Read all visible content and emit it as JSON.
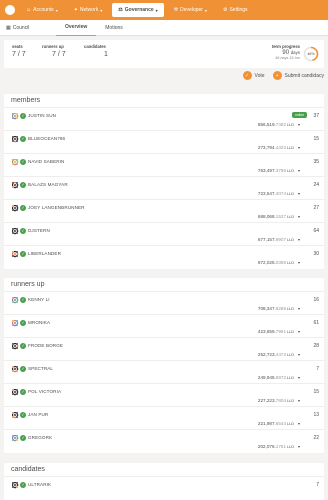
{
  "nav": {
    "items": [
      {
        "label": "Accounts",
        "icon": "user-icon",
        "glyph": "☺",
        "active": false
      },
      {
        "label": "Network",
        "icon": "network-icon",
        "glyph": "✦",
        "active": false
      },
      {
        "label": "Governance",
        "icon": "governance-icon",
        "glyph": "⚖",
        "active": true
      },
      {
        "label": "Developer",
        "icon": "code-icon",
        "glyph": "⚒",
        "active": false
      },
      {
        "label": "Settings",
        "icon": "gear-icon",
        "glyph": "⚙",
        "active": false
      }
    ],
    "accent": "#f19135"
  },
  "subnav": {
    "breadcrumb": "Council",
    "tabs": [
      "Overview",
      "Motions"
    ],
    "active_tab": "Overview"
  },
  "summary": {
    "seats_label": "seats",
    "seats_value": "7 / 7",
    "runners_label": "runners up",
    "runners_value": "7 / 7",
    "candidates_label": "candidates",
    "candidates_value": "1",
    "term_label": "term progress",
    "term_value": "90",
    "term_unit": "days",
    "term_remaining": "48 days 15 hrs",
    "progress_text": "46%",
    "progress_fraction": 0.46
  },
  "actions": {
    "vote": "Vote",
    "submit": "Submit candidacy"
  },
  "members": {
    "title": "members",
    "rows": [
      {
        "name": "JUSTIN SUN",
        "badge": "online",
        "count": "37",
        "bal_int": "856,519.",
        "bal_dec": "7492",
        "unit": "LLD"
      },
      {
        "name": "BLUEOCEAN786",
        "badge": "",
        "count": "15",
        "bal_int": "273,794.",
        "bal_dec": "4323",
        "unit": "LLD"
      },
      {
        "name": "NAVID SABERIN",
        "badge": "",
        "count": "35",
        "bal_int": "763,497.",
        "bal_dec": "3756",
        "unit": "LLD"
      },
      {
        "name": "BALAZS MAGYAR",
        "badge": "",
        "count": "24",
        "bal_int": "723,547.",
        "bal_dec": "4074",
        "unit": "LLD"
      },
      {
        "name": "JOEY LANGENBRUNNER",
        "badge": "",
        "count": "27",
        "bal_int": "688,068.",
        "bal_dec": "1527",
        "unit": "LLD"
      },
      {
        "name": "DJSTERN",
        "badge": "",
        "count": "64",
        "bal_int": "677,157.",
        "bal_dec": "9907",
        "unit": "LLD"
      },
      {
        "name": "LIBERLANDER",
        "badge": "",
        "count": "30",
        "bal_int": "972,025.",
        "bal_dec": "0388",
        "unit": "LLD"
      }
    ]
  },
  "runners": {
    "title": "runners up",
    "rows": [
      {
        "name": "KENNY LI",
        "badge": "",
        "count": "16",
        "bal_int": "708,347.",
        "bal_dec": "8286",
        "unit": "LLD"
      },
      {
        "name": "MRONIKA",
        "badge": "",
        "count": "61",
        "bal_int": "423,659.",
        "bal_dec": "7961",
        "unit": "LLD"
      },
      {
        "name": "FRODE BORGE",
        "badge": "",
        "count": "28",
        "bal_int": "252,723.",
        "bal_dec": "4472",
        "unit": "LLD"
      },
      {
        "name": "SPECTRAL",
        "badge": "",
        "count": "7",
        "bal_int": "249,945.",
        "bal_dec": "6972",
        "unit": "LLD"
      },
      {
        "name": "POL VICTORIA",
        "badge": "",
        "count": "15",
        "bal_int": "227,223.",
        "bal_dec": "7804",
        "unit": "LLD"
      },
      {
        "name": "JAN PUR",
        "badge": "",
        "count": "13",
        "bal_int": "221,987.",
        "bal_dec": "6544",
        "unit": "LLD"
      },
      {
        "name": "GREGORK",
        "badge": "",
        "count": "22",
        "bal_int": "202,076.",
        "bal_dec": "1751",
        "unit": "LLD"
      }
    ]
  },
  "candidates": {
    "title": "candidates",
    "rows": [
      {
        "name": "ULTRARIK",
        "badge": "",
        "count": "7"
      }
    ]
  }
}
